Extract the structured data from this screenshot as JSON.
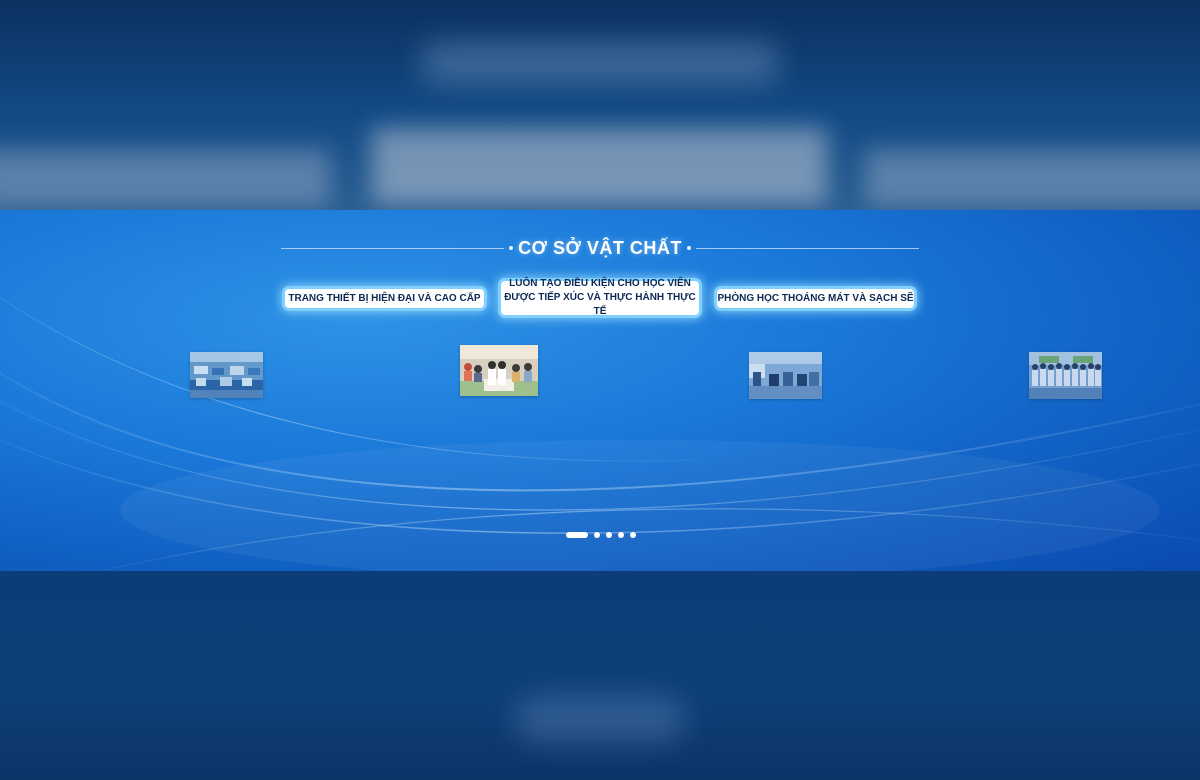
{
  "section": {
    "title": "CƠ SỞ VẬT CHẤT"
  },
  "tabs": [
    {
      "lines": [
        "TRANG THIẾT BỊ HIỆN ĐẠI VÀ CAO CẤP"
      ]
    },
    {
      "lines": [
        "LUÔN TẠO ĐIỀU KIỆN CHO HỌC VIÊN",
        "ĐƯỢC TIẾP XÚC VÀ THỰC HÀNH THỰC TẾ"
      ]
    },
    {
      "lines": [
        "PHÒNG HỌC THOÁNG MÁT VÀ SẠCH SẼ"
      ]
    }
  ],
  "gallery": {
    "thumbnails": [
      {
        "icon": "photo-classroom-equipment"
      },
      {
        "icon": "photo-students-practice"
      },
      {
        "icon": "photo-classroom-study"
      },
      {
        "icon": "photo-class-group"
      }
    ]
  },
  "pagination": {
    "count": 5,
    "active_index": 0
  },
  "colors": {
    "accent": "#1a78d8",
    "tab_glow": "#7fd0ff",
    "tab_text": "#0d2a55"
  }
}
